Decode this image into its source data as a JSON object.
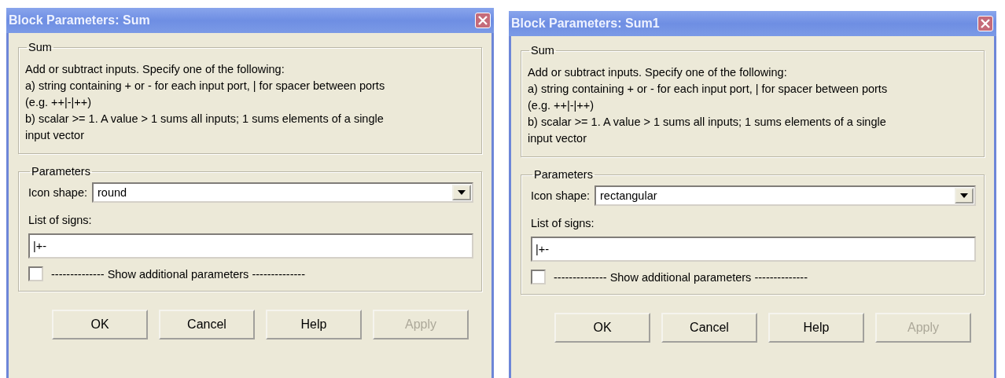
{
  "dialogs": [
    {
      "title": "Block Parameters: Sum",
      "description_group": "Sum",
      "description_lines": [
        "Add or subtract inputs.  Specify one of the following:",
        "a) string containing + or - for each input port, | for spacer between ports",
        "(e.g. ++|-|++)",
        "b) scalar >= 1. A value > 1 sums all inputs; 1 sums elements of a single",
        "input vector"
      ],
      "parameters_group": "Parameters",
      "icon_shape_label": "Icon shape:",
      "icon_shape_value": "round",
      "signs_label": "List of signs:",
      "signs_value": "|+-",
      "show_additional": {
        "label": "-------------- Show additional parameters --------------",
        "checked": false
      },
      "buttons": [
        {
          "label": "OK",
          "disabled": false
        },
        {
          "label": "Cancel",
          "disabled": false
        },
        {
          "label": "Help",
          "disabled": false
        },
        {
          "label": "Apply",
          "disabled": true
        }
      ]
    },
    {
      "title": "Block Parameters: Sum1",
      "description_group": "Sum",
      "description_lines": [
        "Add or subtract inputs.  Specify one of the following:",
        "a) string containing + or - for each input port, | for spacer between ports",
        "(e.g. ++|-|++)",
        "b) scalar >= 1. A value > 1 sums all inputs; 1 sums elements of a single",
        "input vector"
      ],
      "parameters_group": "Parameters",
      "icon_shape_label": "Icon shape:",
      "icon_shape_value": "rectangular",
      "signs_label": "List of signs:",
      "signs_value": "|+-",
      "show_additional": {
        "label": "-------------- Show additional parameters --------------",
        "checked": false
      },
      "buttons": [
        {
          "label": "OK",
          "disabled": false
        },
        {
          "label": "Cancel",
          "disabled": false
        },
        {
          "label": "Help",
          "disabled": false
        },
        {
          "label": "Apply",
          "disabled": true
        }
      ]
    }
  ]
}
